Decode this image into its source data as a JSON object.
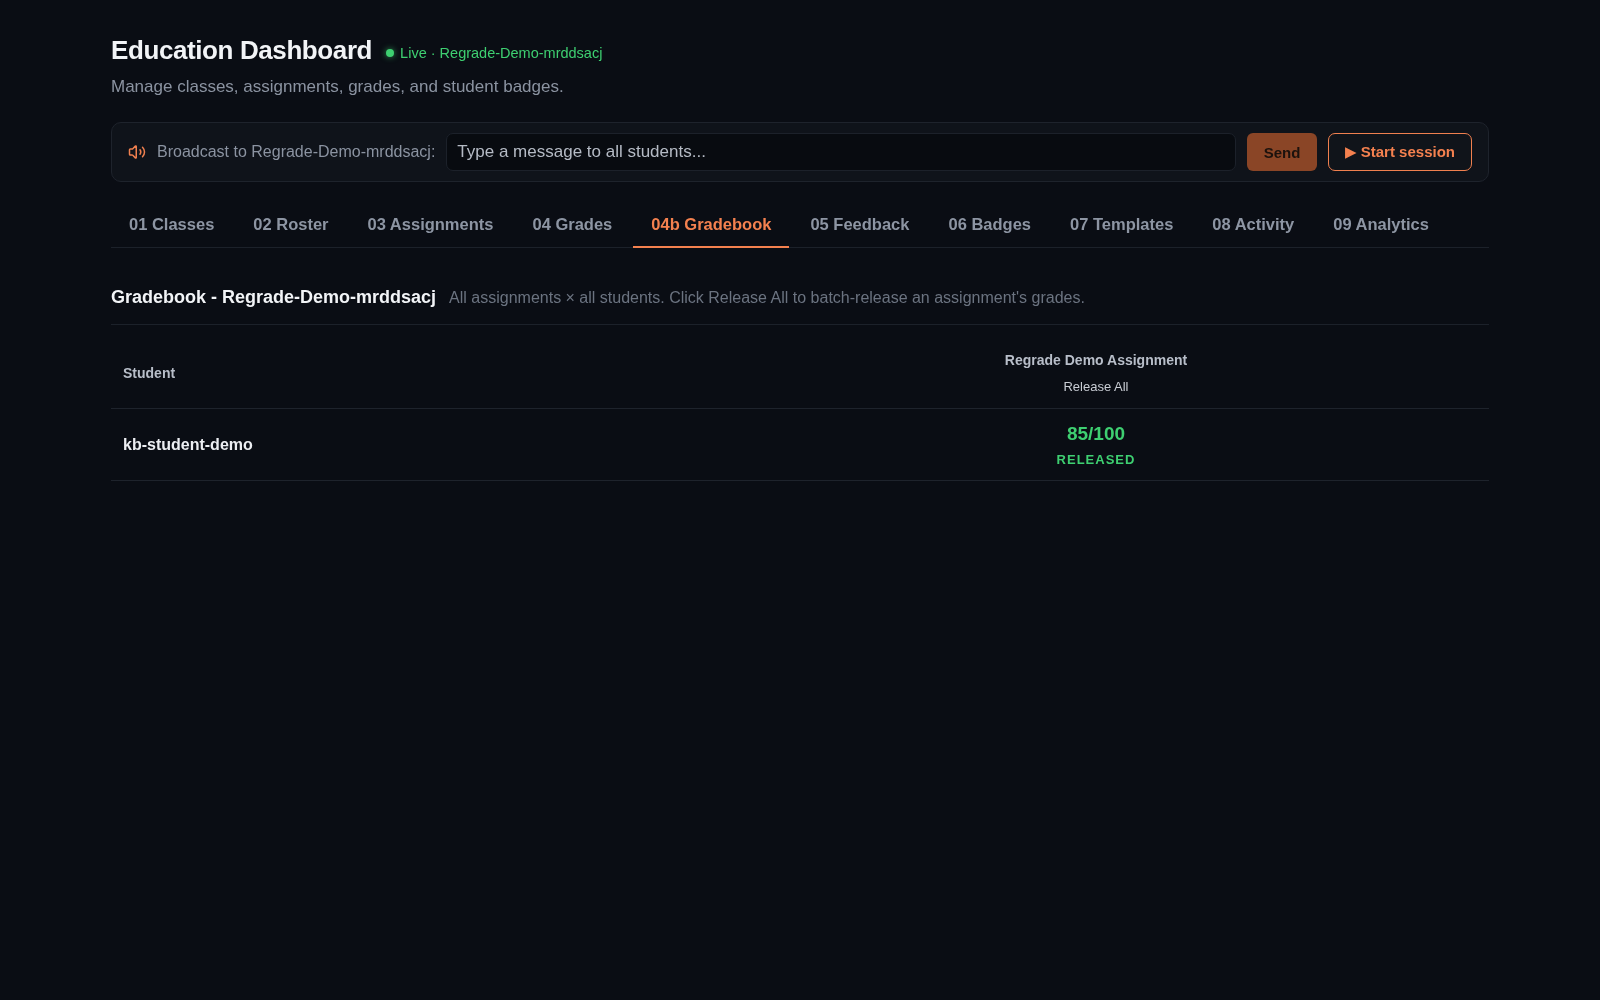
{
  "header": {
    "title": "Education Dashboard",
    "status": {
      "live": true,
      "text": "Live · Regrade-Demo-mrddsacj"
    },
    "subtitle": "Manage classes, assignments, grades, and student badges."
  },
  "broadcast": {
    "label": "Broadcast to Regrade-Demo-mrddsacj:",
    "placeholder": "Type a message to all students...",
    "send_button": "Send",
    "session_button": "▶ Start session"
  },
  "tabs": [
    {
      "label": "01 Classes",
      "selected": false
    },
    {
      "label": "02 Roster",
      "selected": false
    },
    {
      "label": "03 Assignments",
      "selected": false
    },
    {
      "label": "04 Grades",
      "selected": false
    },
    {
      "label": "04b Gradebook",
      "selected": true
    },
    {
      "label": "05 Feedback",
      "selected": false
    },
    {
      "label": "06 Badges",
      "selected": false
    },
    {
      "label": "07 Templates",
      "selected": false
    },
    {
      "label": "08 Activity",
      "selected": false
    },
    {
      "label": "09 Analytics",
      "selected": false
    }
  ],
  "gradebook": {
    "title": "Gradebook - Regrade-Demo-mrddsacj",
    "description": "All assignments × all students. Click Release All to batch-release an assignment's grades.",
    "columns": [
      {
        "kind": "student",
        "label": "Student"
      },
      {
        "kind": "assignment",
        "label": "Regrade Demo Assignment",
        "action": "Release All"
      }
    ],
    "rows": [
      {
        "cells": [
          {
            "kind": "student",
            "text": "kb-student-demo"
          },
          {
            "kind": "grade",
            "score": "85/100",
            "status": "RELEASED",
            "released": true
          }
        ]
      }
    ]
  }
}
